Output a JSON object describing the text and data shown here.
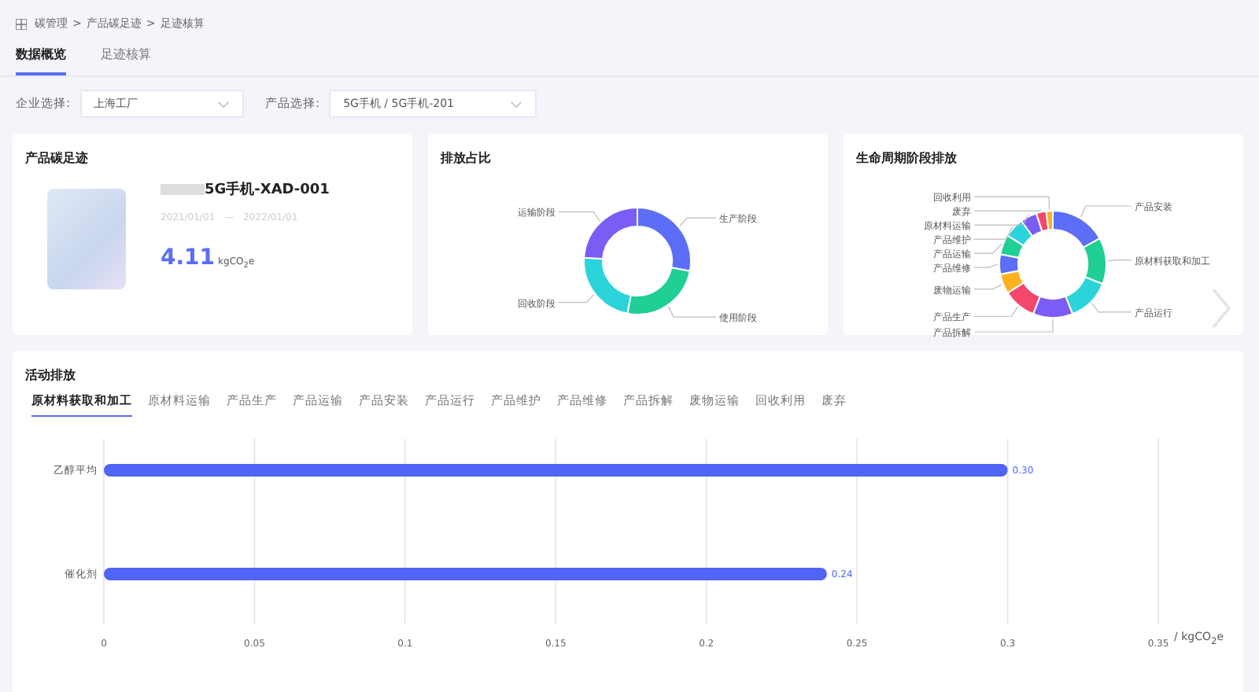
{
  "breadcrumb": {
    "items": [
      "碳管理",
      "产品碳足迹",
      "足迹核算"
    ],
    "separator": ">"
  },
  "tabs": [
    {
      "label": "数据概览",
      "selected": true
    },
    {
      "label": "足迹核算",
      "selected": false
    }
  ],
  "filters": [
    {
      "label": "企业选择:",
      "value": "上海工厂"
    },
    {
      "label": "产品选择:",
      "value": "5G手机 / 5G手机-201"
    }
  ],
  "product_card": {
    "title": "产品碳足迹",
    "name": "5G手机-XAD-001",
    "date_start": "2021/01/01",
    "date_separator": "—",
    "date_end": "2022/01/01",
    "value": "4.11",
    "unit": "kgCO$_{2}$e"
  },
  "share_card": {
    "title": "排放占比",
    "chart_data": {
      "type": "donut",
      "categories": [
        "生产阶段",
        "使用阶段",
        "回收阶段",
        "运输阶段"
      ],
      "series": [
        {
          "colors": [
            "#5b6ef5",
            "#1fcf95",
            "#2bd4d9",
            "#7b5cf5"
          ],
          "values": [
            28,
            25,
            23,
            24
          ]
        }
      ]
    }
  },
  "lifecycle_card": {
    "title": "生命周期阶段排放",
    "chart_data": {
      "type": "donut",
      "categories": [
        "产品安装",
        "原材料获取和加工",
        "产品运行",
        "产品拆解",
        "产品生产",
        "废物运输",
        "产品维修",
        "产品运输",
        "产品维护",
        "原材料运输",
        "废弃",
        "回收利用"
      ],
      "series": [
        {
          "colors": [
            "#5b6ef5",
            "#1fcf95",
            "#2bd4d9",
            "#7b5cf5",
            "#f5476b",
            "#fbb321",
            "#5b6ef5",
            "#1fcf95",
            "#2bd4d9",
            "#7b5cf5",
            "#f5476b",
            "#fbb321"
          ],
          "values": [
            17,
            14,
            13,
            12,
            10,
            6,
            6,
            6,
            6,
            5,
            3,
            2
          ]
        }
      ]
    }
  },
  "activity_card": {
    "title": "活动排放",
    "tabs": [
      {
        "label": "原材料获取和加工",
        "selected": true
      },
      {
        "label": "原材料运输",
        "selected": false
      },
      {
        "label": "产品生产",
        "selected": false
      },
      {
        "label": "产品运输",
        "selected": false
      },
      {
        "label": "产品安装",
        "selected": false
      },
      {
        "label": "产品运行",
        "selected": false
      },
      {
        "label": "产品维护",
        "selected": false
      },
      {
        "label": "产品维修",
        "selected": false
      },
      {
        "label": "产品拆解",
        "selected": false
      },
      {
        "label": "废物运输",
        "selected": false
      },
      {
        "label": "回收利用",
        "selected": false
      },
      {
        "label": "废弃",
        "selected": false
      }
    ],
    "chart_data": {
      "type": "bar",
      "orientation": "horizontal",
      "xlabel": "/ kgCO$_{2}$e",
      "categories": [
        "乙醇平均",
        "催化剂"
      ],
      "grid": true,
      "series": [
        {
          "color": "#5064f5",
          "values": [
            0.3,
            0.24
          ]
        }
      ],
      "value_labels": [
        "0.30",
        "0.24"
      ],
      "xlim": [
        0,
        0.35
      ],
      "xticks": [
        {
          "value": 0,
          "label": "0"
        },
        {
          "value": 0.05,
          "label": "0.05"
        },
        {
          "value": 0.1,
          "label": "0.1"
        },
        {
          "value": 0.15,
          "label": "0.15"
        },
        {
          "value": 0.2,
          "label": "0.2"
        },
        {
          "value": 0.25,
          "label": "0.25"
        },
        {
          "value": 0.3,
          "label": "0.3"
        },
        {
          "value": 0.35,
          "label": "0.35"
        }
      ]
    }
  }
}
